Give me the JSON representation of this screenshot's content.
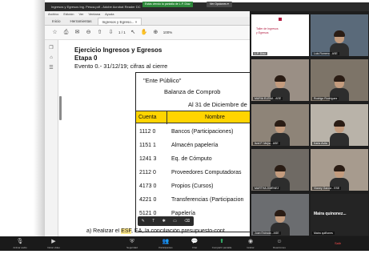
{
  "window": {
    "title": "Ingresos y Egresos Ing. Pesca.pdf - Adobe Acrobat Reader DC",
    "share_banner": "Estás viendo la pantalla de L.P. Díaz",
    "view_options": "Ver Opciones ▾"
  },
  "menubar": [
    "Archivo",
    "Edición",
    "Ver",
    "Ventana",
    "Ayuda"
  ],
  "tabs": [
    {
      "label": "Inicio"
    },
    {
      "label": "Herramientas"
    },
    {
      "label": "Ingresos y Egreso... ×"
    }
  ],
  "toolbar": {
    "icons": [
      "save-icon",
      "print-icon",
      "email-icon",
      "zoom-out-icon",
      "previous-page-icon",
      "next-page-icon",
      "cursor-icon",
      "hand-icon",
      "zoom-in-icon"
    ],
    "page": "1 / 1",
    "zoom": "100%"
  },
  "document": {
    "title": "Ejercicio Ingresos y Egresos",
    "stage": "Etapa 0",
    "event": "Evento 0.- 31/12/19; cifras al cierre",
    "entity": "\"Ente Público\"",
    "report": "Balanza de Comprob",
    "as_of": "Al 31 de Diciembre de",
    "columns": [
      "Cuenta",
      "Nombre"
    ],
    "rows": [
      {
        "code": "1112 0",
        "name": "Bancos (Participaciones)"
      },
      {
        "code": "1151 1",
        "name": "Almacén papelería"
      },
      {
        "code": "1241 3",
        "name": "Eq. de Cómputo"
      },
      {
        "code": "2112 0",
        "name": "Proveedores Computadoras"
      },
      {
        "code": "4173 0",
        "name": "Propios (Cursos)"
      },
      {
        "code": "4221 0",
        "name": "Transferencias (Participacion"
      },
      {
        "code": "5121 0",
        "name": "Papelería"
      }
    ],
    "footnote_pre": "a)   Realizar el ",
    "footnote_highlight": "ESF",
    "footnote_post": ", EA, la conciliación presupuesto-cont"
  },
  "annotation_toolbar": [
    "✎",
    "T",
    "✱",
    "▭",
    "⌫"
  ],
  "gallery": {
    "slide_title": "Taller de Ingresos y Egresos",
    "participants": [
      {
        "name": "L.P. Díaz"
      },
      {
        "name": "Luis Romero - ASE"
      },
      {
        "name": "MARIA ELENA - ASE"
      },
      {
        "name": "Rodrigo Rodríguez"
      },
      {
        "name": "Itzel P. Mejía - ASE"
      },
      {
        "name": "Karla Ávila"
      },
      {
        "name": "MARTHA JIMÉNEZ"
      },
      {
        "name": "Vianey García - ESE"
      },
      {
        "name": "Juan Estrada - ASE"
      },
      {
        "name": "Maira quiñones"
      }
    ],
    "name_only_caption": "Maira quinonez..."
  },
  "controls": [
    {
      "icon": "microphone-icon",
      "label": "Activar audio"
    },
    {
      "icon": "video-icon",
      "label": "Iniciar video"
    },
    {
      "icon": "security-icon",
      "label": "Seguridad"
    },
    {
      "icon": "participants-icon",
      "label": "Participantes"
    },
    {
      "icon": "chat-icon",
      "label": "Chat"
    },
    {
      "icon": "share-screen-icon",
      "label": "Compartir pantalla"
    },
    {
      "icon": "record-icon",
      "label": "Grabar"
    },
    {
      "icon": "reactions-icon",
      "label": "Reacciones"
    }
  ],
  "leave_label": "Salir"
}
